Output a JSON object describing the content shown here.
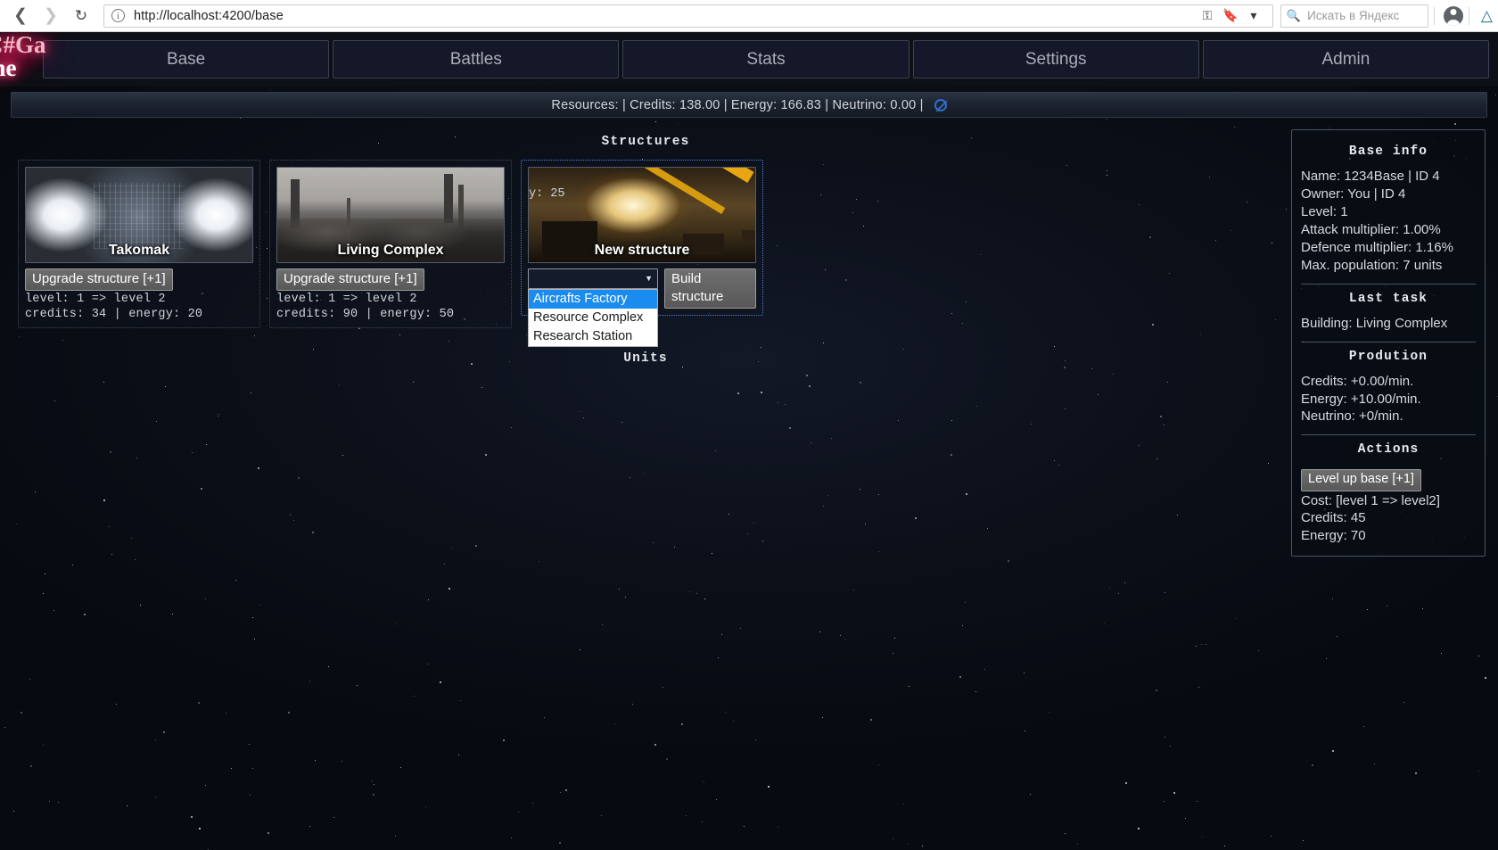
{
  "browser": {
    "back_icon": "back-arrow-icon",
    "forward_icon": "forward-arrow-icon",
    "reload_icon": "reload-icon",
    "url": "http://localhost:4200/base",
    "site_info_icon": "info-icon",
    "key_icon": "key-icon",
    "bookmark_icon": "bookmark-icon",
    "dropdown_icon": "chevron-down-icon",
    "search_engine_glyph": "Q",
    "search_placeholder": "Искать в Яндекс",
    "profile_icon": "user-avatar-icon",
    "yandex_icon": "yandex-browser-icon"
  },
  "app": {
    "logo_line1": "C#Ga",
    "logo_line2": "me",
    "nav": [
      {
        "label": "Base"
      },
      {
        "label": "Battles"
      },
      {
        "label": "Stats"
      },
      {
        "label": "Settings"
      },
      {
        "label": "Admin"
      }
    ],
    "resources_text": "Resources: | Credits: 138.00 | Energy: 166.83 | Neutrino: 0.00 |",
    "resources_icon": "no-entry-icon"
  },
  "sections": {
    "structures_title": "Structures",
    "units_title": "Units"
  },
  "structures": [
    {
      "name": "Takomak",
      "art": "tokamak",
      "button": "Upgrade structure [+1]",
      "level_line": "level: 1 => level 2",
      "cost_line": "credits: 34 | energy: 20"
    },
    {
      "name": "Living Complex",
      "art": "living",
      "button": "Upgrade structure [+1]",
      "level_line": "level: 1 => level 2",
      "cost_line": "credits: 90 | energy: 50"
    }
  ],
  "new_structure": {
    "name": "New structure",
    "art": "build",
    "build_button": "Build structure",
    "select_value": "",
    "options": [
      {
        "label": "Aircrafts Factory",
        "highlighted": true
      },
      {
        "label": "Resource Complex",
        "highlighted": false
      },
      {
        "label": "Research Station",
        "highlighted": false
      }
    ],
    "behind_cost_line": "y: 25"
  },
  "base_info": {
    "title": "Base info",
    "lines": [
      "Name: 1234Base | ID 4",
      "Owner: You | ID 4",
      "Level: 1",
      "Attack multiplier: 1.00%",
      "Defence multiplier: 1.16%",
      "Max. population: 7 units"
    ]
  },
  "last_task": {
    "title": "Last task",
    "value": "Building: Living Complex"
  },
  "production": {
    "title": "Prodution",
    "lines": [
      "Credits: +0.00/min.",
      "Energy: +10.00/min.",
      "Neutrino: +0/min."
    ]
  },
  "actions": {
    "title": "Actions",
    "button": "Level up base [+1]",
    "cost_title": "Cost: [level 1 => level2]",
    "cost_credits": "Credits: 45",
    "cost_energy": "Energy: 70"
  },
  "colors": {
    "accent": "#1a8cf0",
    "panel_border": "#4c5462",
    "logo_glow": "#ff1f5e"
  }
}
